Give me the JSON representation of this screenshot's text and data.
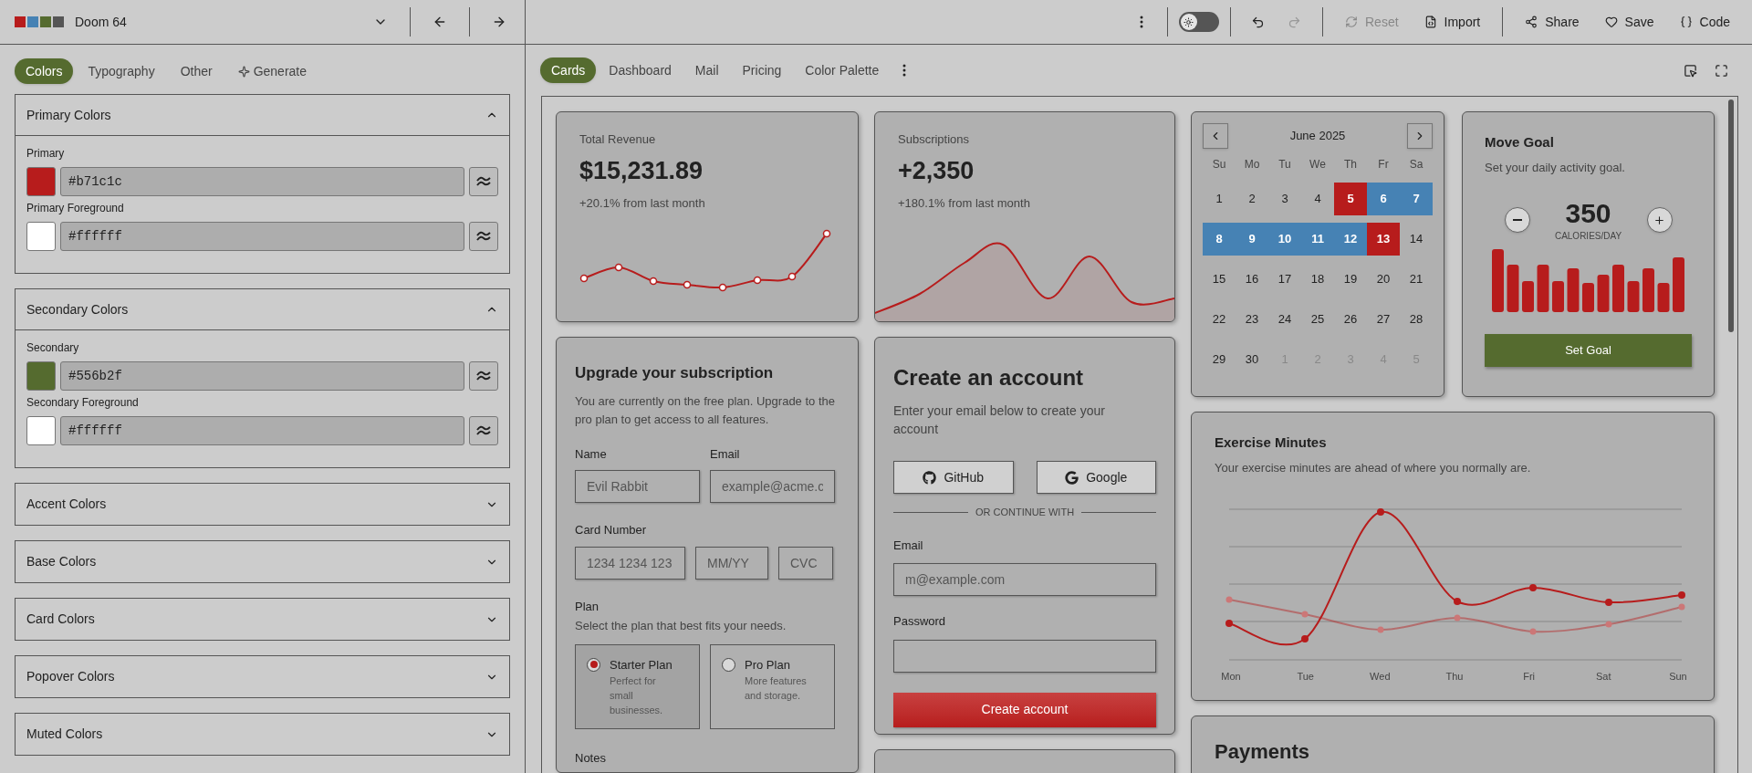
{
  "theme": {
    "name": "Doom 64",
    "swatches": [
      {
        "color": "#b71c1c"
      },
      {
        "color": "#4682b4"
      },
      {
        "color": "#556b2f"
      },
      {
        "color": "#555555"
      }
    ]
  },
  "editor_tabs": [
    {
      "label": "Colors",
      "selected": true,
      "kind": "plain"
    },
    {
      "label": "Typography",
      "selected": false,
      "kind": "plain"
    },
    {
      "label": "Other",
      "selected": false,
      "kind": "plain"
    },
    {
      "label": "Generate",
      "selected": false,
      "kind": "sparkle"
    }
  ],
  "sections": [
    {
      "title": "Primary Colors",
      "expanded": true,
      "fields": [
        {
          "label": "Primary",
          "value": "#b71c1c",
          "color": "#b71c1c"
        },
        {
          "label": "Primary Foreground",
          "value": "#ffffff",
          "color": "#ffffff"
        }
      ]
    },
    {
      "title": "Secondary Colors",
      "expanded": true,
      "fields": [
        {
          "label": "Secondary",
          "value": "#556b2f",
          "color": "#556b2f"
        },
        {
          "label": "Secondary Foreground",
          "value": "#ffffff",
          "color": "#ffffff"
        }
      ]
    },
    {
      "title": "Accent Colors",
      "expanded": false
    },
    {
      "title": "Base Colors",
      "expanded": false
    },
    {
      "title": "Card Colors",
      "expanded": false
    },
    {
      "title": "Popover Colors",
      "expanded": false
    },
    {
      "title": "Muted Colors",
      "expanded": false
    }
  ],
  "toolbar": {
    "dark_mode": false,
    "history": [
      {
        "kind": "undo",
        "disabled": false
      },
      {
        "kind": "redo",
        "disabled": true
      }
    ],
    "action_groups": [
      [
        {
          "label": "Reset",
          "kind": "reset",
          "disabled": true
        },
        {
          "label": "Import",
          "kind": "import",
          "disabled": false
        }
      ],
      [
        {
          "label": "Share",
          "kind": "share",
          "disabled": false
        },
        {
          "label": "Save",
          "kind": "save",
          "disabled": false
        },
        {
          "label": "Code",
          "kind": "code",
          "disabled": false
        }
      ]
    ]
  },
  "preview_tabs": [
    {
      "label": "Cards",
      "selected": true
    },
    {
      "label": "Dashboard",
      "selected": false
    },
    {
      "label": "Mail",
      "selected": false
    },
    {
      "label": "Pricing",
      "selected": false
    },
    {
      "label": "Color Palette",
      "selected": false
    }
  ],
  "revenue": {
    "label": "Total Revenue",
    "value": "$15,231.89",
    "change": "+20.1% from last month"
  },
  "subscriptions": {
    "label": "Subscriptions",
    "value": "+2,350",
    "change": "+180.1% from last month"
  },
  "calendar": {
    "month": "June 2025",
    "weekdays": [
      "Su",
      "Mo",
      "Tu",
      "We",
      "Th",
      "Fr",
      "Sa"
    ],
    "days": [
      {
        "label": "1",
        "kind": "day"
      },
      {
        "label": "2",
        "kind": "day"
      },
      {
        "label": "3",
        "kind": "day"
      },
      {
        "label": "4",
        "kind": "day"
      },
      {
        "label": "5",
        "kind": "range_edge"
      },
      {
        "label": "6",
        "kind": "range_middle"
      },
      {
        "label": "7",
        "kind": "range_middle"
      },
      {
        "label": "8",
        "kind": "range_middle"
      },
      {
        "label": "9",
        "kind": "range_middle"
      },
      {
        "label": "10",
        "kind": "range_middle"
      },
      {
        "label": "11",
        "kind": "range_middle"
      },
      {
        "label": "12",
        "kind": "range_middle"
      },
      {
        "label": "13",
        "kind": "range_edge"
      },
      {
        "label": "14",
        "kind": "day"
      },
      {
        "label": "15",
        "kind": "day"
      },
      {
        "label": "16",
        "kind": "day"
      },
      {
        "label": "17",
        "kind": "day"
      },
      {
        "label": "18",
        "kind": "day"
      },
      {
        "label": "19",
        "kind": "day"
      },
      {
        "label": "20",
        "kind": "day"
      },
      {
        "label": "21",
        "kind": "day"
      },
      {
        "label": "22",
        "kind": "day"
      },
      {
        "label": "23",
        "kind": "day"
      },
      {
        "label": "24",
        "kind": "day"
      },
      {
        "label": "25",
        "kind": "day"
      },
      {
        "label": "26",
        "kind": "day"
      },
      {
        "label": "27",
        "kind": "day"
      },
      {
        "label": "28",
        "kind": "day"
      },
      {
        "label": "29",
        "kind": "day"
      },
      {
        "label": "30",
        "kind": "day"
      },
      {
        "label": "1",
        "kind": "outside"
      },
      {
        "label": "2",
        "kind": "outside"
      },
      {
        "label": "3",
        "kind": "outside"
      },
      {
        "label": "4",
        "kind": "outside"
      },
      {
        "label": "5",
        "kind": "outside"
      }
    ]
  },
  "move_goal": {
    "title": "Move Goal",
    "description": "Set your daily activity goal.",
    "value": "350",
    "unit": "CALORIES/DAY",
    "button": "Set Goal"
  },
  "upgrade": {
    "title": "Upgrade your subscription",
    "description": "You are currently on the free plan. Upgrade to the pro plan to get access to all features.",
    "name_label": "Name",
    "name_value": "Evil Rabbit",
    "email_label": "Email",
    "email_placeholder": "example@acme.c",
    "card_label": "Card Number",
    "card_placeholder": "1234 1234 123",
    "expiry_placeholder": "MM/YY",
    "cvc_placeholder": "CVC",
    "plan_label": "Plan",
    "plan_hint": "Select the plan that best fits your needs.",
    "plans": [
      {
        "name": "Starter Plan",
        "description": "Perfect for small businesses.",
        "selected": true
      },
      {
        "name": "Pro Plan",
        "description": "More features and storage.",
        "selected": false
      }
    ],
    "notes_label": "Notes"
  },
  "create_account": {
    "title": "Create an account",
    "description": "Enter your email below to create your account",
    "providers": [
      {
        "label": "GitHub",
        "kind": "github"
      },
      {
        "label": "Google",
        "kind": "google"
      }
    ],
    "divider": "OR CONTINUE WITH",
    "email_label": "Email",
    "email_placeholder": "m@example.com",
    "password_label": "Password",
    "button": "Create account"
  },
  "exercise": {
    "title": "Exercise Minutes",
    "description": "Your exercise minutes are ahead of where you normally are.",
    "days": [
      "Mon",
      "Tue",
      "Wed",
      "Thu",
      "Fri",
      "Sat",
      "Sun"
    ]
  },
  "payments": {
    "title": "Payments"
  }
}
